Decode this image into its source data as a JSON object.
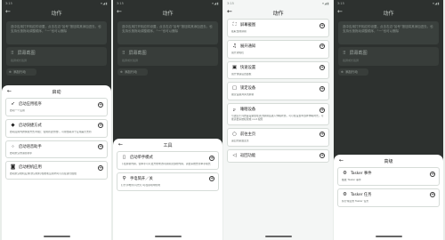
{
  "status": {
    "time": "3:15",
    "icons": "▾◢▮"
  },
  "screen_dim": {
    "title": "动作",
    "banner": "选中应用打开相应的设置，点击右边“加号”按钮将其添加进去。也支持长按拖动调整顺序，“一”也可以删除",
    "actions_card": {
      "label": "屏幕截图",
      "sub": "截屏或长截屏"
    },
    "pill": "添加行动"
  },
  "sheet_launch": {
    "title": "启动",
    "items": [
      {
        "icon": "rocket-icon",
        "glyph": "🚀",
        "title": "启动应用程序",
        "desc": "启动一个应用"
      },
      {
        "icon": "shortcut-icon",
        "glyph": "⌖",
        "title": "启动快捷方式",
        "desc": "启动应用内的快捷方式(例如：使用新建文档)，可用性取决于应用是否支持"
      },
      {
        "icon": "assistant-icon",
        "glyph": "⁖",
        "title": "启动语音助手",
        "desc": "启动默认的语音助手"
      },
      {
        "icon": "camera-icon",
        "glyph": "◙",
        "title": "启动相机应用",
        "desc": "启动默认相机应用(默认相机)在相机应用内可以直接进行拍摄"
      }
    ]
  },
  "sheet_tools": {
    "title": "工具",
    "items": [
      {
        "icon": "one-hand-icon",
        "glyph": "▯",
        "title": "启动单手模式",
        "desc": "下拉屏幕内容，使单手可以更方便地访问屏幕顶部的内容，需要系统支持单手模式"
      },
      {
        "icon": "flashlight-icon",
        "glyph": "⚲",
        "title": "手电筒开／关",
        "desc": "打开手电筒(闪光灯)可在黑暗中照明"
      }
    ]
  },
  "screen_actions": {
    "title": "动作",
    "items": [
      {
        "icon": "screenshot-icon",
        "glyph": "⛶",
        "title": "屏幕截图",
        "desc": "截取当前屏幕"
      },
      {
        "icon": "bell-icon",
        "glyph": "🔔",
        "title": "展开通知",
        "desc": "展开通知栏"
      },
      {
        "icon": "quick-settings-icon",
        "glyph": "▣",
        "title": "快速设置",
        "desc": "展开快速设置面板"
      },
      {
        "icon": "lock-screen-icon",
        "glyph": "▢",
        "title": "锁定设备",
        "desc": "锁定设备并关闭屏幕"
      },
      {
        "icon": "sleep-icon",
        "glyph": "zᶻ",
        "title": "睡眠设备",
        "desc": "与锁定不同的是设备会在关闭屏幕后进入休眠状态，可以在设置中选择休眠时长。可能需要系统权限或 root 权限"
      },
      {
        "icon": "home-icon",
        "glyph": "○",
        "title": "前往主页",
        "desc": "返回到桌面主页"
      },
      {
        "icon": "back-icon",
        "glyph": "◁",
        "title": "返回功能",
        "desc": ""
      }
    ]
  },
  "sheet_advanced": {
    "title": "高级",
    "items": [
      {
        "icon": "tasker-event-icon",
        "glyph": "⚙",
        "title": "Tasker 事件",
        "desc": "触发 Tasker 事件"
      },
      {
        "icon": "tasker-task-icon",
        "glyph": "⚙",
        "title": "Tasker 任务",
        "desc": "执行特定的 Tasker 任务"
      }
    ]
  }
}
